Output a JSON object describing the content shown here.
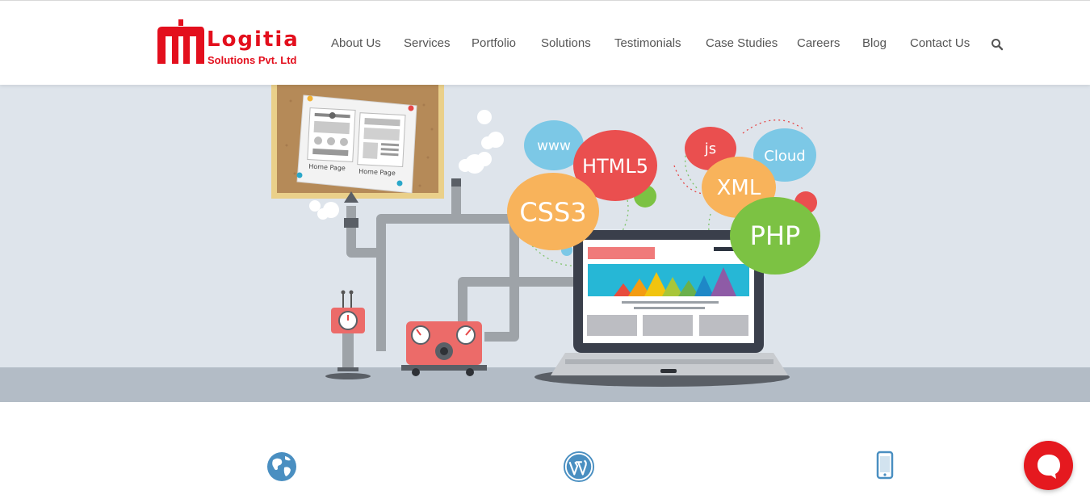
{
  "brand": {
    "name": "Logitia",
    "tagline": "Solutions Pvt. Ltd",
    "color": "#e30f1d"
  },
  "nav": {
    "items": [
      {
        "label": "About Us"
      },
      {
        "label": "Services"
      },
      {
        "label": "Portfolio"
      },
      {
        "label": "Solutions"
      },
      {
        "label": "Testimonials"
      },
      {
        "label": "Case Studies"
      },
      {
        "label": "Careers"
      },
      {
        "label": "Blog"
      },
      {
        "label": "Contact Us"
      }
    ],
    "search_icon": "search-icon"
  },
  "hero": {
    "board_card_labels": [
      "Home Page",
      "Home Page"
    ],
    "bubbles": [
      "www",
      "HTML5",
      "CSS3",
      "js",
      "Cloud",
      "XML",
      "PHP"
    ]
  },
  "features": {
    "icons": [
      "globe-icon",
      "wordpress-icon",
      "mobile-phone-icon"
    ],
    "icon_color": "#4a8fc1"
  },
  "chat": {
    "icon": "chat-icon",
    "color": "#e5191f"
  }
}
